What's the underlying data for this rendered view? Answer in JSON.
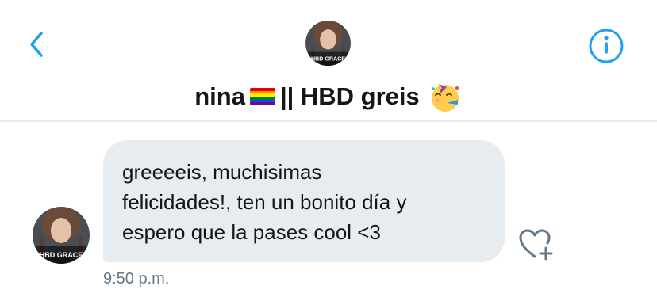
{
  "header": {
    "name_prefix": "nina",
    "name_suffix": "|| HBD greis",
    "avatar_caption": "HBD GRACE",
    "flag_colors": [
      "#e40303",
      "#ff8c00",
      "#ffed00",
      "#008026",
      "#004dff",
      "#750787"
    ]
  },
  "message": {
    "text": "greeeeis, muchisimas\nfelicidades!, ten un bonito día y\nespero que la pases cool <3",
    "time": "9:50 p.m.",
    "avatar_caption": "HBD GRACE"
  },
  "icons": {
    "back": "chevron-left-icon",
    "info": "info-icon",
    "flag": "rainbow-flag-icon",
    "party": "partying-face-icon",
    "like": "heart-plus-icon"
  },
  "colors": {
    "accent": "#1da1f2",
    "bubble": "#e6ecf0",
    "text": "#14171a",
    "muted": "#657786"
  }
}
